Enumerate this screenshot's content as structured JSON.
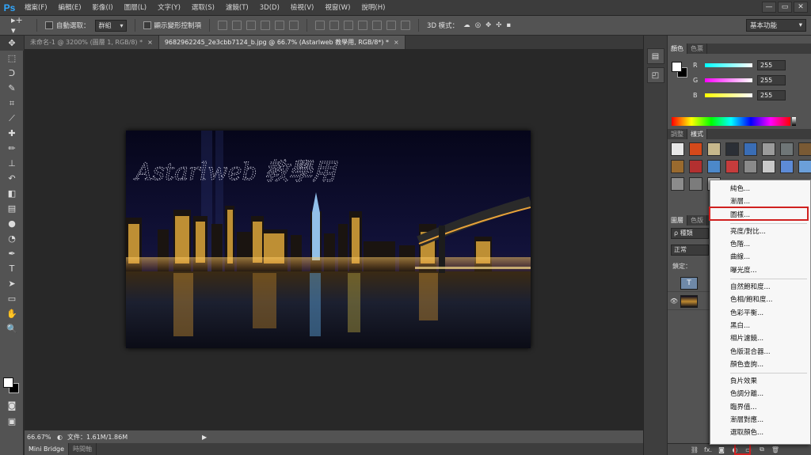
{
  "app": {
    "logo": "Ps"
  },
  "menu": [
    "檔案(F)",
    "編輯(E)",
    "影像(I)",
    "圖層(L)",
    "文字(Y)",
    "選取(S)",
    "濾鏡(T)",
    "3D(D)",
    "檢視(V)",
    "視窗(W)",
    "說明(H)"
  ],
  "window_controls": {
    "minimize": "—",
    "restore": "▭",
    "close": "✕"
  },
  "options": {
    "auto_select_label": "自動選取：",
    "auto_select_value": "群組",
    "show_transform_label": "顯示變形控制項",
    "mode_3d_label": "3D 模式：",
    "workspace": "基本功能"
  },
  "documents": [
    {
      "title": "未命名-1 @ 3200% (圖層 1, RGB/8) *",
      "close": "×",
      "active": false
    },
    {
      "title": "9682962245_2e3cbb7124_b.jpg @ 66.7% (Astarlweb 教學用, RGB/8*) *",
      "close": "×",
      "active": true
    }
  ],
  "canvas": {
    "watermark": "Astarlweb 教學用"
  },
  "status": {
    "zoom": "66.67%",
    "doc_info": "文件：1.61M/1.86M",
    "arrow": "▶"
  },
  "bottom_tabs": [
    "Mini Bridge",
    "時間軸"
  ],
  "color_panel": {
    "tabs": [
      "顏色",
      "色票"
    ],
    "r_label": "R",
    "g_label": "G",
    "b_label": "B",
    "r": "255",
    "g": "255",
    "b": "255"
  },
  "styles_panel": {
    "tabs": [
      "調整",
      "樣式"
    ],
    "swatches": [
      "#e8e8e8",
      "#d4491a",
      "#c7b88c",
      "#2b2f36",
      "#3a6db5",
      "#9b9b9b",
      "#6f7677",
      "#7a5a34",
      "#9a6a2e",
      "#b33030",
      "#4c88c9",
      "#c63c3c",
      "#8a8a8a",
      "#c9c9c9",
      "#5d8bd6",
      "#6b9fd9",
      "#8c8c8c",
      "#7c7c7c",
      "#b3b3b3"
    ]
  },
  "layers_panel": {
    "tabs": [
      "圖層",
      "色版"
    ],
    "search": "ρ 種類",
    "blend_mode": "正常",
    "lock_label": "鎖定：",
    "layers": [
      {
        "eye": "",
        "thumb": "T"
      },
      {
        "eye": "👁",
        "thumb": ""
      }
    ]
  },
  "layer_toolbar": [
    "⛓",
    "fx.",
    "◙",
    "◐",
    "▭",
    "⧉",
    "🗑"
  ],
  "adjustment_menu": {
    "group1": [
      "純色...",
      "漸層...",
      "圖樣..."
    ],
    "group2": [
      "亮度/對比...",
      "色階...",
      "曲線...",
      "曝光度..."
    ],
    "group3": [
      "自然飽和度...",
      "色相/飽和度...",
      "色彩平衡...",
      "黑白...",
      "相片濾鏡...",
      "色版混合器...",
      "顏色查詢..."
    ],
    "group4": [
      "負片效果",
      "色調分離...",
      "臨界值...",
      "漸層對應...",
      "選取顏色..."
    ],
    "highlighted": "圖樣..."
  },
  "tools": [
    "move-icon",
    "marquee-icon",
    "lasso-icon",
    "quick-select-icon",
    "crop-icon",
    "eyedropper-icon",
    "healing-icon",
    "brush-icon",
    "stamp-icon",
    "history-brush-icon",
    "eraser-icon",
    "gradient-icon",
    "blur-icon",
    "dodge-icon",
    "pen-icon",
    "type-icon",
    "path-select-icon",
    "shape-icon",
    "hand-icon",
    "zoom-icon"
  ]
}
